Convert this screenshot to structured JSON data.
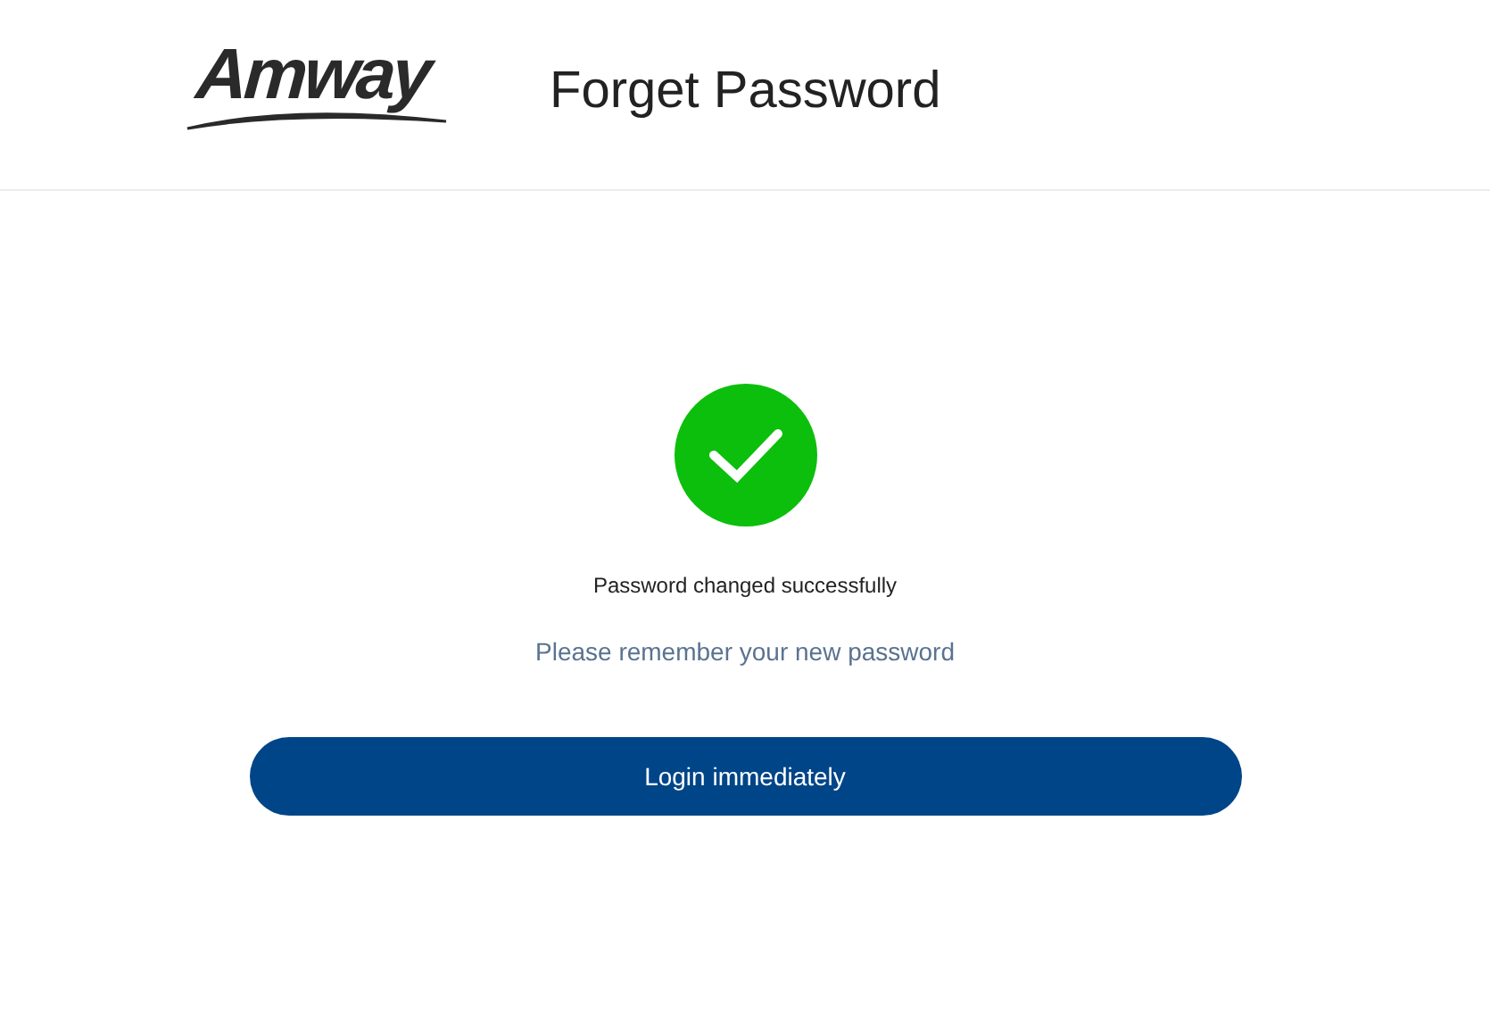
{
  "header": {
    "logo": "Amway",
    "title": "Forget Password"
  },
  "result": {
    "success": true,
    "message": "Password changed successfully",
    "hint": "Please remember your new password"
  },
  "buttons": [
    {
      "label": "Login immediately"
    }
  ]
}
